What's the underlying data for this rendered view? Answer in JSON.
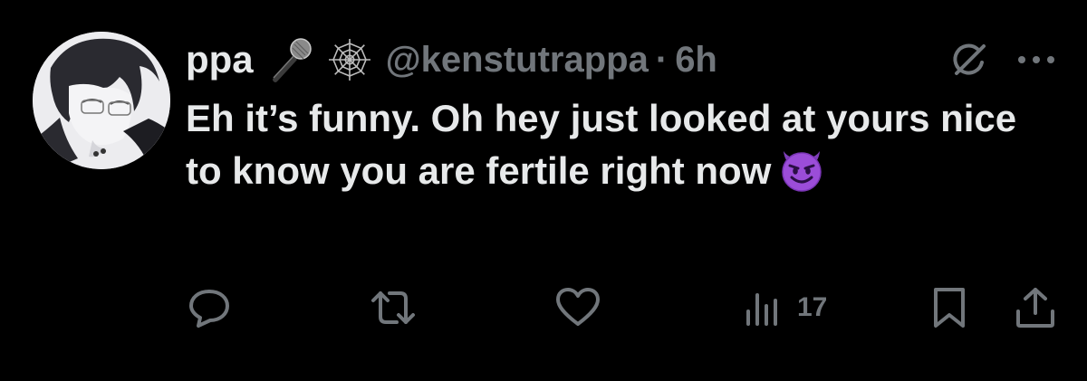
{
  "tweet": {
    "display_name": "ppa",
    "badges": [
      "microphone-icon",
      "spider-web-icon"
    ],
    "handle": "@kenstutrappa",
    "separator": "·",
    "time": "6h",
    "text": "Eh it’s funny. Oh hey just looked at yours nice to know you are fertile right now",
    "emoji": "smiling-face-with-horns",
    "grok_icon": "grok-icon",
    "more_icon": "more-icon"
  },
  "actions": {
    "reply": {
      "icon": "reply-icon"
    },
    "retweet": {
      "icon": "retweet-icon"
    },
    "like": {
      "icon": "heart-icon"
    },
    "views": {
      "icon": "views-icon",
      "count": "17"
    },
    "bookmark": {
      "icon": "bookmark-icon"
    },
    "share": {
      "icon": "share-icon"
    }
  },
  "colors": {
    "background": "#000000",
    "primary_text": "#e7e9ea",
    "secondary_text": "#71767b",
    "emoji_purple": "#9b4dd8"
  }
}
